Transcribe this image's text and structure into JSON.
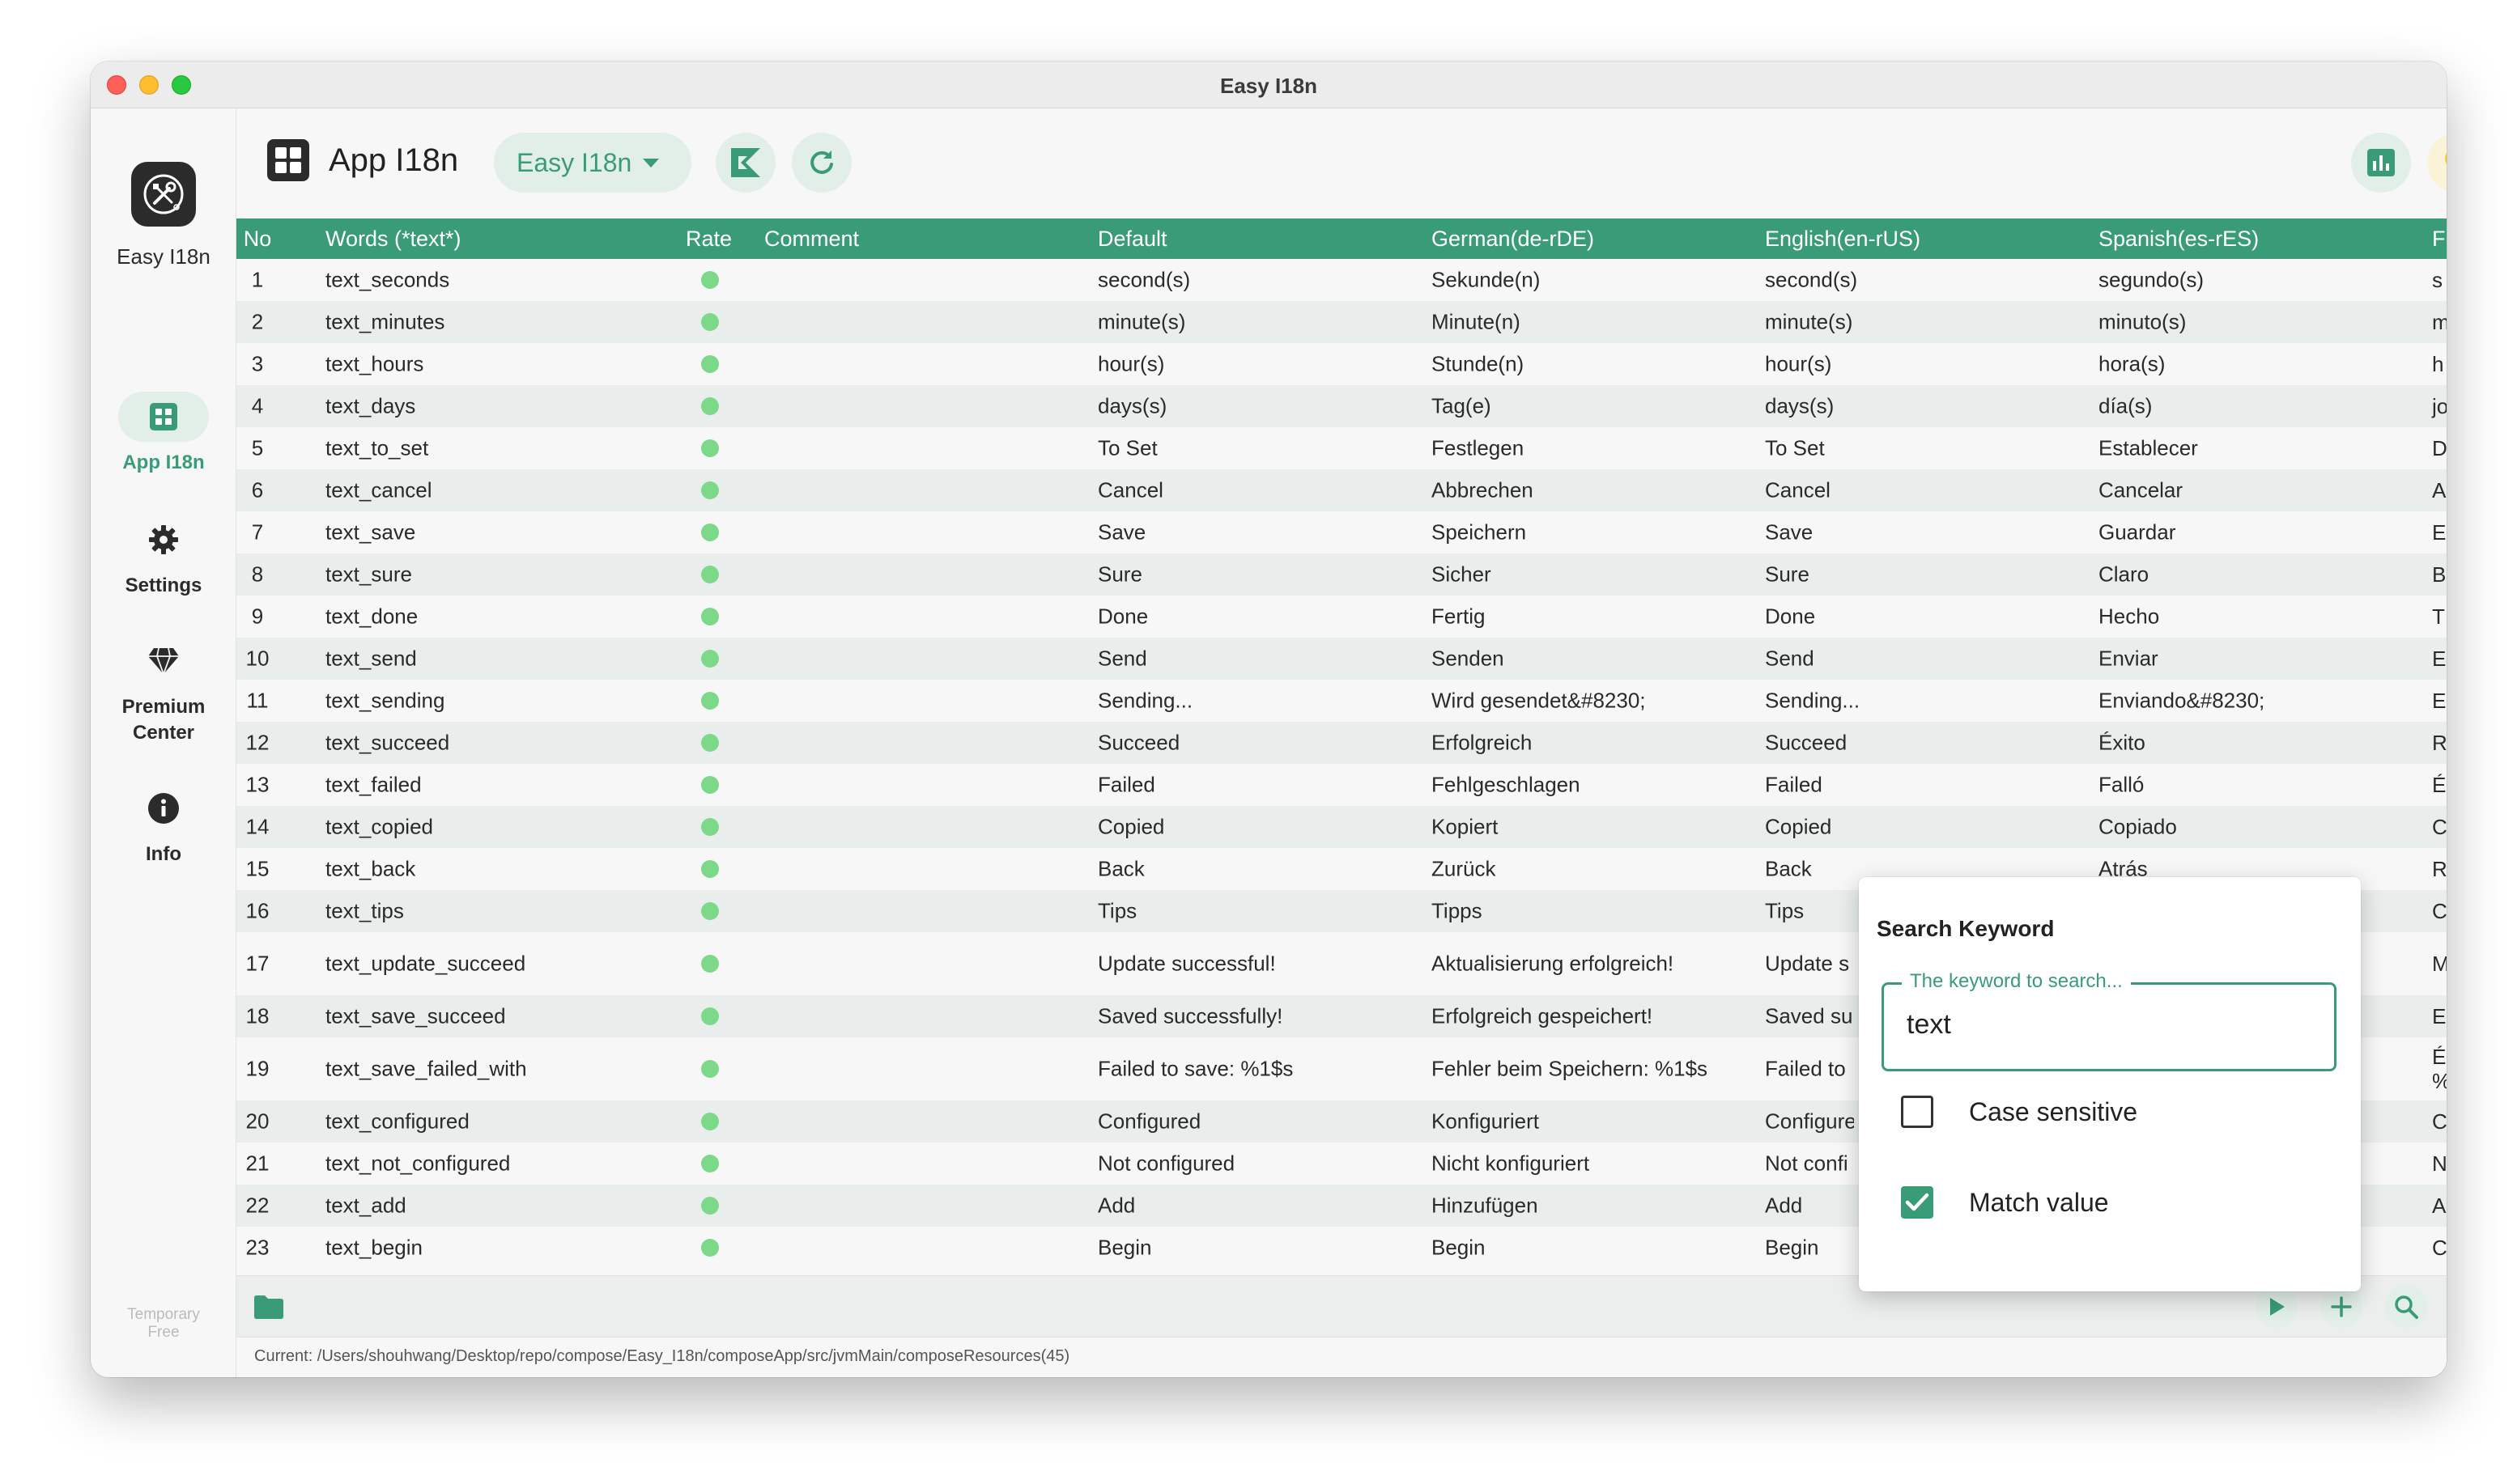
{
  "window": {
    "title": "Easy I18n"
  },
  "sidebar": {
    "app_name": "Easy I18n",
    "items": [
      {
        "label": "App I18n",
        "icon": "grid-icon",
        "active": true
      },
      {
        "label": "Settings",
        "icon": "gear-icon",
        "active": false
      },
      {
        "label": "Premium\nCenter",
        "icon": "diamond-icon",
        "active": false
      },
      {
        "label": "Info",
        "icon": "info-icon",
        "active": false
      }
    ],
    "footer": "Temporary\nFree"
  },
  "header": {
    "title": "App I18n",
    "project": "Easy I18n",
    "buttons": [
      "kotlin-icon",
      "refresh-icon",
      "chart-icon",
      "bulb-icon"
    ]
  },
  "table": {
    "columns": [
      "No",
      "Words (*text*)",
      "Rate",
      "Comment",
      "Default",
      "German(de-rDE)",
      "English(en-rUS)",
      "Spanish(es-rES)",
      "F"
    ],
    "rows": [
      {
        "no": "1",
        "key": "text_seconds",
        "default": "second(s)",
        "de": "Sekunde(n)",
        "en": "second(s)",
        "es": "segundo(s)",
        "fr": "s"
      },
      {
        "no": "2",
        "key": "text_minutes",
        "default": "minute(s)",
        "de": "Minute(n)",
        "en": "minute(s)",
        "es": "minuto(s)",
        "fr": "m"
      },
      {
        "no": "3",
        "key": "text_hours",
        "default": "hour(s)",
        "de": "Stunde(n)",
        "en": "hour(s)",
        "es": "hora(s)",
        "fr": "h"
      },
      {
        "no": "4",
        "key": "text_days",
        "default": "days(s)",
        "de": "Tag(e)",
        "en": "days(s)",
        "es": "día(s)",
        "fr": "jo"
      },
      {
        "no": "5",
        "key": "text_to_set",
        "default": "To Set",
        "de": "Festlegen",
        "en": "To Set",
        "es": "Establecer",
        "fr": "D"
      },
      {
        "no": "6",
        "key": "text_cancel",
        "default": "Cancel",
        "de": "Abbrechen",
        "en": "Cancel",
        "es": "Cancelar",
        "fr": "A"
      },
      {
        "no": "7",
        "key": "text_save",
        "default": "Save",
        "de": "Speichern",
        "en": "Save",
        "es": "Guardar",
        "fr": "E"
      },
      {
        "no": "8",
        "key": "text_sure",
        "default": "Sure",
        "de": "Sicher",
        "en": "Sure",
        "es": "Claro",
        "fr": "B"
      },
      {
        "no": "9",
        "key": "text_done",
        "default": "Done",
        "de": "Fertig",
        "en": "Done",
        "es": "Hecho",
        "fr": "T"
      },
      {
        "no": "10",
        "key": "text_send",
        "default": "Send",
        "de": "Senden",
        "en": "Send",
        "es": "Enviar",
        "fr": "E"
      },
      {
        "no": "11",
        "key": "text_sending",
        "default": "Sending...",
        "de": "Wird gesendet&#8230;",
        "en": "Sending...",
        "es": "Enviando&#8230;",
        "fr": "E"
      },
      {
        "no": "12",
        "key": "text_succeed",
        "default": "Succeed",
        "de": "Erfolgreich",
        "en": "Succeed",
        "es": "Éxito",
        "fr": "R"
      },
      {
        "no": "13",
        "key": "text_failed",
        "default": "Failed",
        "de": "Fehlgeschlagen",
        "en": "Failed",
        "es": "Falló",
        "fr": "É"
      },
      {
        "no": "14",
        "key": "text_copied",
        "default": "Copied",
        "de": "Kopiert",
        "en": "Copied",
        "es": "Copiado",
        "fr": "C"
      },
      {
        "no": "15",
        "key": "text_back",
        "default": "Back",
        "de": "Zurück",
        "en": "Back",
        "es": "Atrás",
        "fr": "R"
      },
      {
        "no": "16",
        "key": "text_tips",
        "default": "Tips",
        "de": "Tipps",
        "en": "Tips",
        "es": "",
        "fr": "C"
      },
      {
        "no": "17",
        "key": "text_update_succeed",
        "default": "Update successful!",
        "de": "Aktualisierung erfolgreich!",
        "en": "Update s",
        "es": "",
        "fr": "M"
      },
      {
        "no": "18",
        "key": "text_save_succeed",
        "default": "Saved successfully!",
        "de": "Erfolgreich gespeichert!",
        "en": "Saved su",
        "es": "",
        "fr": "E"
      },
      {
        "no": "19",
        "key": "text_save_failed_with",
        "default": "Failed to save: %1$s",
        "de": "Fehler beim Speichern: %1$s",
        "en": "Failed to",
        "es": "",
        "fr": "É\n%"
      },
      {
        "no": "20",
        "key": "text_configured",
        "default": "Configured",
        "de": "Konfiguriert",
        "en": "Configure",
        "es": "",
        "fr": "C"
      },
      {
        "no": "21",
        "key": "text_not_configured",
        "default": "Not configured",
        "de": "Nicht konfiguriert",
        "en": "Not confi",
        "es": "",
        "fr": "N"
      },
      {
        "no": "22",
        "key": "text_add",
        "default": "Add",
        "de": "Hinzufügen",
        "en": "Add",
        "es": "",
        "fr": "A"
      },
      {
        "no": "23",
        "key": "text_begin",
        "default": "Begin",
        "de": "Begin",
        "en": "Begin",
        "es": "",
        "fr": "C"
      }
    ]
  },
  "toolbar": {
    "buttons": [
      "folder-icon",
      "play-icon",
      "plus-icon",
      "search-icon",
      "filter-icon"
    ]
  },
  "status": {
    "path": "Current: /Users/shouhwang/Desktop/repo/compose/Easy_I18n/composeApp/src/jvmMain/composeResources(45)"
  },
  "search_popup": {
    "title": "Search Keyword",
    "field_label": "The keyword to search...",
    "value": "text",
    "options": [
      {
        "label": "Case sensitive",
        "checked": false
      },
      {
        "label": "Match value",
        "checked": true
      }
    ]
  },
  "colors": {
    "accent": "#3a9c76",
    "accent_light": "#e2efe8",
    "rate_dot": "#7dd98a"
  }
}
